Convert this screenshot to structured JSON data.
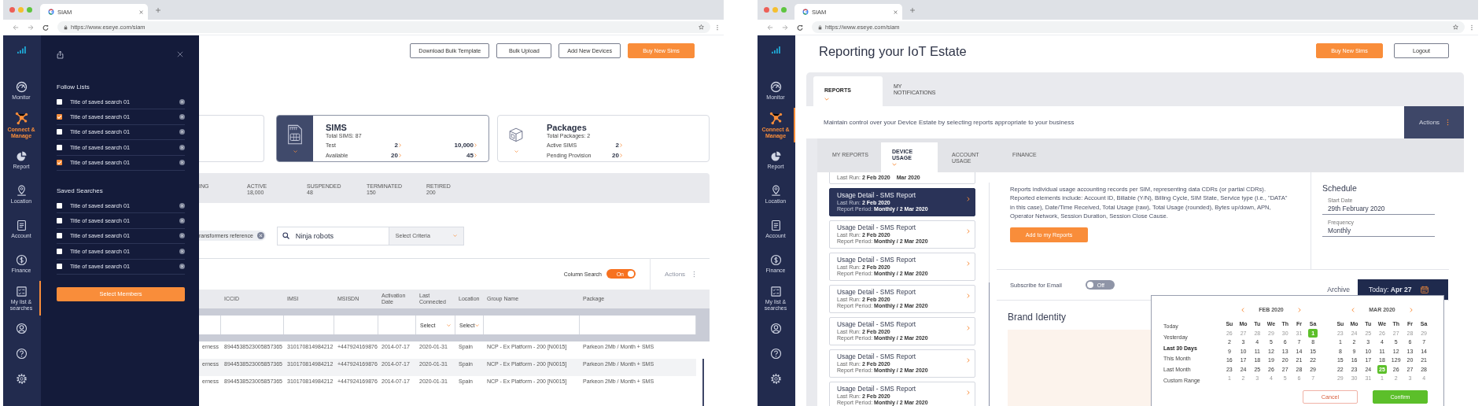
{
  "windows": [
    {
      "kind": "devices",
      "tab_title": "SIAM",
      "url": "https://www.eseye.com/siam",
      "nav": [
        {
          "kind": "monitor",
          "label": "Monitor",
          "selected": false,
          "indicator": false
        },
        {
          "kind": "connect",
          "label": "Connect & Manage",
          "selected": true,
          "indicator": false
        },
        {
          "kind": "report",
          "label": "Report",
          "selected": false,
          "indicator": false
        },
        {
          "kind": "location",
          "label": "Location",
          "selected": false,
          "indicator": false
        },
        {
          "kind": "account",
          "label": "Account",
          "selected": false,
          "indicator": false
        },
        {
          "kind": "finance",
          "label": "Finance",
          "selected": false,
          "indicator": false
        },
        {
          "kind": "lists",
          "label": "My list & searches",
          "selected": false,
          "indicator": true
        },
        {
          "kind": "user",
          "selected": false,
          "indicator": false
        },
        {
          "kind": "help",
          "selected": false,
          "indicator": false
        },
        {
          "kind": "settings",
          "selected": false,
          "indicator": false
        }
      ],
      "panel": {
        "follow_title": "Follow Lists",
        "follow": [
          {
            "label": "Title of saved search 01",
            "checked": false
          },
          {
            "label": "Title of saved search 01",
            "checked": true
          },
          {
            "label": "Title of saved search 01",
            "checked": false
          },
          {
            "label": "Title of saved search 01",
            "checked": false
          },
          {
            "label": "Title of saved search 01",
            "checked": true
          }
        ],
        "saved_title": "Saved Searches",
        "saved": [
          {
            "label": "Title of saved search 01",
            "checked": false
          },
          {
            "label": "Title of saved search 01",
            "checked": false
          },
          {
            "label": "Title of saved search 01",
            "checked": false
          },
          {
            "label": "Title of saved search 01",
            "checked": false
          },
          {
            "label": "Title of saved search 01",
            "checked": false
          }
        ],
        "button": "Select Members"
      },
      "buttons": [
        {
          "label": "Download Bulk Template",
          "primary": false
        },
        {
          "label": "Bulk Upload",
          "primary": false
        },
        {
          "label": "Add New Devices",
          "primary": false
        },
        {
          "label": "Buy New Sims",
          "primary": true
        }
      ],
      "cards": [
        {
          "kind": "partial",
          "selected": false
        },
        {
          "kind": "sims",
          "selected": true,
          "title": "SIMS",
          "subtitle": "Total SIMS: 87",
          "rows": [
            {
              "label": "Test",
              "values": [
                "2",
                "10,000"
              ]
            },
            {
              "label": "Available",
              "values": [
                "20",
                "45"
              ]
            }
          ]
        },
        {
          "kind": "packages",
          "selected": false,
          "title": "Packages",
          "subtitle": "Total Packages: 2",
          "rows": [
            {
              "label": "Active SIMS",
              "values": [
                "2"
              ]
            },
            {
              "label": "Pending Provision",
              "values": [
                "20"
              ]
            }
          ]
        }
      ],
      "statuses": [
        {
          "label": "ING"
        },
        {
          "label": "ACTIVE",
          "value": "18,000"
        },
        {
          "label": "SUSPENDED",
          "value": "48"
        },
        {
          "label": "TERMINATED",
          "value": "150"
        },
        {
          "label": "RETIRED",
          "value": "200"
        }
      ],
      "chip": "ransformers reference",
      "search": {
        "value": "Ninja robots",
        "criteria": "Select Criteria"
      },
      "column_search": {
        "label": "Column Search",
        "on": true,
        "state_text": "On"
      },
      "actions": "Actions",
      "table": {
        "columns": [
          "",
          "ICCID",
          "IMSI",
          "MSISDN",
          "Activation Date",
          "Last Connected",
          "Location",
          "Group Name",
          "Package"
        ],
        "filters": [
          {
            "kind": "blank"
          },
          {
            "kind": "blank"
          },
          {
            "kind": "blank"
          },
          {
            "kind": "blank"
          },
          {
            "kind": "blank"
          },
          {
            "kind": "select",
            "label": "Select"
          },
          {
            "kind": "select",
            "label": "Select"
          },
          {
            "kind": "blank"
          },
          {
            "kind": "blank"
          }
        ],
        "rows": [
          [
            "erness",
            "8944538523005857365",
            "310170814984212",
            "+447924169876",
            "2014-07-17",
            "2020-01-31",
            "Spain",
            "NCP - Ex Platform - 200 [N0015]",
            "Parkeon 2Mb / Month + SMS"
          ],
          [
            "erness",
            "8944538523005857365",
            "310170814984212",
            "+447924169876",
            "2014-07-17",
            "2020-01-31",
            "Spain",
            "NCP - Ex Platform - 200 [N0015]",
            "Parkeon 2Mb / Month + SMS"
          ],
          [
            "erness",
            "8944538523005857365",
            "310170814984212",
            "+447924169876",
            "2014-07-17",
            "2020-01-31",
            "Spain",
            "NCP - Ex Platform - 200 [N0015]",
            "Parkeon 2Mb / Month + SMS"
          ]
        ]
      }
    },
    {
      "kind": "reports",
      "tab_title": "SIAM",
      "url": "https://www.eseye.com/siam",
      "nav": [
        {
          "kind": "monitor",
          "label": "Monitor",
          "selected": false,
          "indicator": false
        },
        {
          "kind": "connect",
          "label": "Connect & Manage",
          "selected": true,
          "indicator": true
        },
        {
          "kind": "report",
          "label": "Report",
          "selected": false,
          "indicator": false
        },
        {
          "kind": "location",
          "label": "Location",
          "selected": false,
          "indicator": false
        },
        {
          "kind": "account",
          "label": "Account",
          "selected": false,
          "indicator": false
        },
        {
          "kind": "finance",
          "label": "Finance",
          "selected": false,
          "indicator": false
        },
        {
          "kind": "lists",
          "label": "My list & searches",
          "selected": false,
          "indicator": false
        },
        {
          "kind": "user",
          "selected": false,
          "indicator": false
        },
        {
          "kind": "help",
          "selected": false,
          "indicator": false
        },
        {
          "kind": "settings",
          "selected": false,
          "indicator": false
        }
      ],
      "title": "Reporting your IoT Estate",
      "buttons": [
        {
          "label": "Buy New Sims",
          "primary": true
        },
        {
          "label": "Logout",
          "primary": false
        }
      ],
      "main_tabs": [
        {
          "label": "REPORTS",
          "selected": true
        },
        {
          "label": "MY NOTIFICATIONS",
          "selected": false
        }
      ],
      "intro": "Maintain control over your Device Estate by selecting reports appropriate to your business",
      "actions": "Actions",
      "sub_tabs": [
        {
          "label": "MY REPORTS",
          "selected": false
        },
        {
          "label": "DEVICE USAGE",
          "selected": true
        },
        {
          "label": "ACCOUNT USAGE",
          "selected": false
        },
        {
          "label": "FINANCE",
          "selected": false
        }
      ],
      "reports": [
        {
          "kind": "partial",
          "selected": false,
          "last_run": "Last Run: **2 Feb 2020**",
          "period": "Mar 2020"
        },
        {
          "kind": "full",
          "selected": true,
          "title": "Usage Detail - SMS Report",
          "last_run": "Last Run: **2 Feb 2020**",
          "period": "Report Period: **Monthly / 2 Mar 2020**"
        },
        {
          "kind": "full",
          "selected": false,
          "title": "Usage Detail - SMS Report",
          "last_run": "Last Run: **2 Feb 2020**",
          "period": "Report Period: **Monthly / 2 Mar 2020**"
        },
        {
          "kind": "full",
          "selected": false,
          "title": "Usage Detail - SMS Report",
          "last_run": "Last Run: **2 Feb 2020**",
          "period": "Report Period: **Monthly / 2 Mar 2020**"
        },
        {
          "kind": "full",
          "selected": false,
          "title": "Usage Detail - SMS Report",
          "last_run": "Last Run: **2 Feb 2020**",
          "period": "Report Period: **Monthly / 2 Mar 2020**"
        },
        {
          "kind": "full",
          "selected": false,
          "title": "Usage Detail - SMS Report",
          "last_run": "Last Run: **2 Feb 2020**",
          "period": "Report Period: **Monthly / 2 Mar 2020**"
        },
        {
          "kind": "full",
          "selected": false,
          "title": "Usage Detail - SMS Report",
          "last_run": "Last Run: **2 Feb 2020**",
          "period": "Report Period: **Monthly / 2 Mar 2020**"
        },
        {
          "kind": "full",
          "selected": false,
          "title": "Usage Detail - SMS Report",
          "last_run": "Last Run: **2 Feb 2020**",
          "period": "Report Period: **Monthly / 2 Mar 2020**"
        }
      ],
      "description": "Reports individual usage accounting records per SIM, representing data CDRs (or partial CDRs). Reported elements include: Account ID, Billable (Y/N), Billing Cycle, SIM State, Service type (i.e., \"DATA\" in this case), Date/Time Received, Total Usage (raw), Total Usage (rounded), Bytes up/down, APN, Operator Network, Session Duration, Session Close Cause.",
      "add_button": "Add to my Reports",
      "schedule": {
        "title": "Schedule",
        "fields": [
          {
            "label": "Start Date",
            "value": "29th February 2020"
          },
          {
            "label": "Frequency",
            "value": "Monthly"
          }
        ]
      },
      "subscribe": {
        "label": "Subscribe for Email",
        "on": false,
        "state_text": "Off"
      },
      "date_tabs": [
        {
          "label": "Archive",
          "selected": false
        },
        {
          "label": "Today: **Apr 27**",
          "selected": true
        }
      ],
      "brand_title": "Brand Identity",
      "calendar": {
        "ranges": [
          {
            "label": "Today",
            "selected": false
          },
          {
            "label": "Yesterday",
            "selected": false
          },
          {
            "label": "Last 30 Days",
            "selected": true
          },
          {
            "label": "This Month",
            "selected": false
          },
          {
            "label": "Last Month",
            "selected": false
          },
          {
            "label": "Custom Range",
            "selected": false
          }
        ],
        "months": [
          {
            "title": "FEB 2020",
            "weekdays": [
              "Su",
              "Mo",
              "Tu",
              "We",
              "Th",
              "Fr",
              "Sa"
            ],
            "days": [
              {
                "text": "26",
                "muted": true,
                "selected": false
              },
              {
                "text": "27",
                "muted": true,
                "selected": false
              },
              {
                "text": "28",
                "muted": true,
                "selected": false
              },
              {
                "text": "29",
                "muted": true,
                "selected": false
              },
              {
                "text": "30",
                "muted": true,
                "selected": false
              },
              {
                "text": "31",
                "muted": true,
                "selected": false
              },
              {
                "text": "1",
                "muted": false,
                "selected": true
              },
              {
                "text": "2",
                "muted": false,
                "selected": false
              },
              {
                "text": "3",
                "muted": false,
                "selected": false
              },
              {
                "text": "4",
                "muted": false,
                "selected": false
              },
              {
                "text": "5",
                "muted": false,
                "selected": false
              },
              {
                "text": "6",
                "muted": false,
                "selected": false
              },
              {
                "text": "7",
                "muted": false,
                "selected": false
              },
              {
                "text": "8",
                "muted": false,
                "selected": false
              },
              {
                "text": "9",
                "muted": false,
                "selected": false
              },
              {
                "text": "10",
                "muted": false,
                "selected": false
              },
              {
                "text": "11",
                "muted": false,
                "selected": false
              },
              {
                "text": "12",
                "muted": false,
                "selected": false
              },
              {
                "text": "13",
                "muted": false,
                "selected": false
              },
              {
                "text": "14",
                "muted": false,
                "selected": false
              },
              {
                "text": "15",
                "muted": false,
                "selected": false
              },
              {
                "text": "16",
                "muted": false,
                "selected": false
              },
              {
                "text": "17",
                "muted": false,
                "selected": false
              },
              {
                "text": "18",
                "muted": false,
                "selected": false
              },
              {
                "text": "19",
                "muted": false,
                "selected": false
              },
              {
                "text": "20",
                "muted": false,
                "selected": false
              },
              {
                "text": "21",
                "muted": false,
                "selected": false
              },
              {
                "text": "22",
                "muted": false,
                "selected": false
              },
              {
                "text": "23",
                "muted": false,
                "selected": false
              },
              {
                "text": "24",
                "muted": false,
                "selected": false
              },
              {
                "text": "25",
                "muted": false,
                "selected": false
              },
              {
                "text": "26",
                "muted": false,
                "selected": false
              },
              {
                "text": "27",
                "muted": false,
                "selected": false
              },
              {
                "text": "28",
                "muted": false,
                "selected": false
              },
              {
                "text": "29",
                "muted": false,
                "selected": false
              },
              {
                "text": "1",
                "muted": true,
                "selected": false
              },
              {
                "text": "2",
                "muted": true,
                "selected": false
              },
              {
                "text": "3",
                "muted": true,
                "selected": false
              },
              {
                "text": "4",
                "muted": true,
                "selected": false
              },
              {
                "text": "5",
                "muted": true,
                "selected": false
              },
              {
                "text": "6",
                "muted": true,
                "selected": false
              },
              {
                "text": "7",
                "muted": true,
                "selected": false
              }
            ]
          },
          {
            "title": "MAR 2020",
            "weekdays": [
              "Su",
              "Mo",
              "Tu",
              "We",
              "Th",
              "Fr",
              "Sa"
            ],
            "days": [
              {
                "text": "23",
                "muted": true,
                "selected": false
              },
              {
                "text": "24",
                "muted": true,
                "selected": false
              },
              {
                "text": "25",
                "muted": true,
                "selected": false
              },
              {
                "text": "26",
                "muted": true,
                "selected": false
              },
              {
                "text": "27",
                "muted": true,
                "selected": false
              },
              {
                "text": "28",
                "muted": true,
                "selected": false
              },
              {
                "text": "29",
                "muted": true,
                "selected": false
              },
              {
                "text": "1",
                "muted": false,
                "selected": false
              },
              {
                "text": "2",
                "muted": false,
                "selected": false
              },
              {
                "text": "3",
                "muted": false,
                "selected": false
              },
              {
                "text": "4",
                "muted": false,
                "selected": false
              },
              {
                "text": "5",
                "muted": false,
                "selected": false
              },
              {
                "text": "6",
                "muted": false,
                "selected": false
              },
              {
                "text": "7",
                "muted": false,
                "selected": false
              },
              {
                "text": "8",
                "muted": false,
                "selected": false
              },
              {
                "text": "9",
                "muted": false,
                "selected": false
              },
              {
                "text": "10",
                "muted": false,
                "selected": false
              },
              {
                "text": "11",
                "muted": false,
                "selected": false
              },
              {
                "text": "12",
                "muted": false,
                "selected": false
              },
              {
                "text": "13",
                "muted": false,
                "selected": false
              },
              {
                "text": "14",
                "muted": false,
                "selected": false
              },
              {
                "text": "15",
                "muted": false,
                "selected": false
              },
              {
                "text": "16",
                "muted": false,
                "selected": false
              },
              {
                "text": "17",
                "muted": false,
                "selected": false
              },
              {
                "text": "18",
                "muted": false,
                "selected": false
              },
              {
                "text": "129",
                "muted": false,
                "selected": false
              },
              {
                "text": "20",
                "muted": false,
                "selected": false
              },
              {
                "text": "21",
                "muted": false,
                "selected": false
              },
              {
                "text": "22",
                "muted": false,
                "selected": false
              },
              {
                "text": "23",
                "muted": false,
                "selected": false
              },
              {
                "text": "24",
                "muted": false,
                "selected": false
              },
              {
                "text": "25",
                "muted": false,
                "selected": true
              },
              {
                "text": "26",
                "muted": false,
                "selected": false
              },
              {
                "text": "27",
                "muted": false,
                "selected": false
              },
              {
                "text": "28",
                "muted": false,
                "selected": false
              },
              {
                "text": "29",
                "muted": true,
                "selected": false
              },
              {
                "text": "30",
                "muted": true,
                "selected": false
              },
              {
                "text": "31",
                "muted": true,
                "selected": false
              },
              {
                "text": "1",
                "muted": true,
                "selected": false
              },
              {
                "text": "2",
                "muted": true,
                "selected": false
              },
              {
                "text": "3",
                "muted": true,
                "selected": false
              },
              {
                "text": "4",
                "muted": true,
                "selected": false
              }
            ]
          }
        ],
        "cancel": "Cancel",
        "confirm": "Confirm"
      }
    }
  ]
}
